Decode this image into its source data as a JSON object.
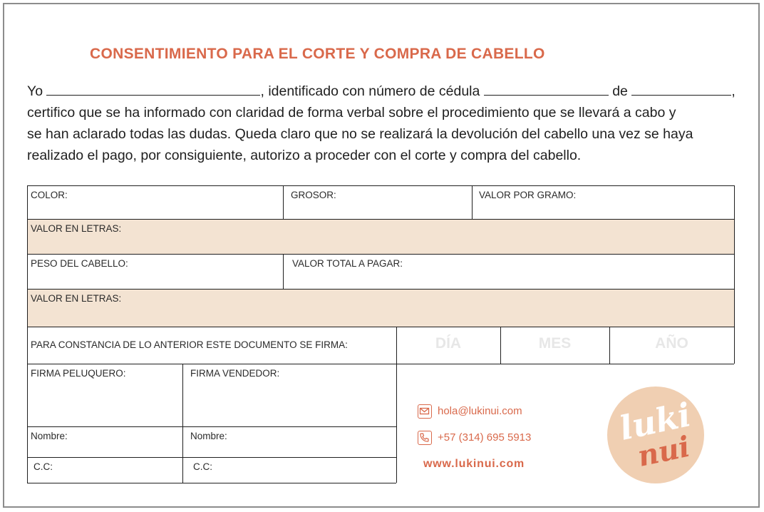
{
  "title": "CONSENTIMIENTO PARA EL CORTE Y COMPRA DE CABELLO",
  "paragraph": {
    "yo": "Yo",
    "identificado": ", identificado con número de cédula",
    "de": "de",
    "comma": ",",
    "line2": "certifico que se ha informado con claridad de forma verbal sobre el procedimiento que se llevará a cabo y",
    "line3": "se han aclarado todas las dudas.  Queda claro que no se realizará la devolución del cabello una vez se haya",
    "line4": "realizado el pago, por consiguiente, autorizo a proceder con el corte y compra del cabello."
  },
  "table": {
    "color": "COLOR:",
    "grosor": "GROSOR:",
    "valor_por_gramo": "VALOR POR GRAMO:",
    "valor_en_letras_1": "VALOR EN LETRAS:",
    "peso_del_cabello": "PESO DEL CABELLO:",
    "valor_total": "VALOR TOTAL A PAGAR:",
    "valor_en_letras_2": "VALOR EN LETRAS:",
    "constancia": "PARA CONSTANCIA DE LO ANTERIOR ESTE DOCUMENTO SE FIRMA:",
    "dia": "DÍA",
    "mes": "MES",
    "anio": "AÑO"
  },
  "signatures": {
    "firma_peluquero": "FIRMA PELUQUERO:",
    "firma_vendedor": "FIRMA VENDEDOR:",
    "nombre_1": "Nombre:",
    "nombre_2": "Nombre:",
    "cc_1": "C.C:",
    "cc_2": "C.C:"
  },
  "contact": {
    "email": "hola@lukinui.com",
    "phone": "+57 (314) 695 5913",
    "website": "www.lukinui.com",
    "email_icon": "envelope-icon",
    "phone_icon": "phone-icon"
  },
  "logo": {
    "text_top": "luki",
    "text_bottom": "nui"
  },
  "colors": {
    "accent": "#d9694b",
    "tan": "#f3e3d2",
    "logo_circle": "#f0cfb2"
  }
}
